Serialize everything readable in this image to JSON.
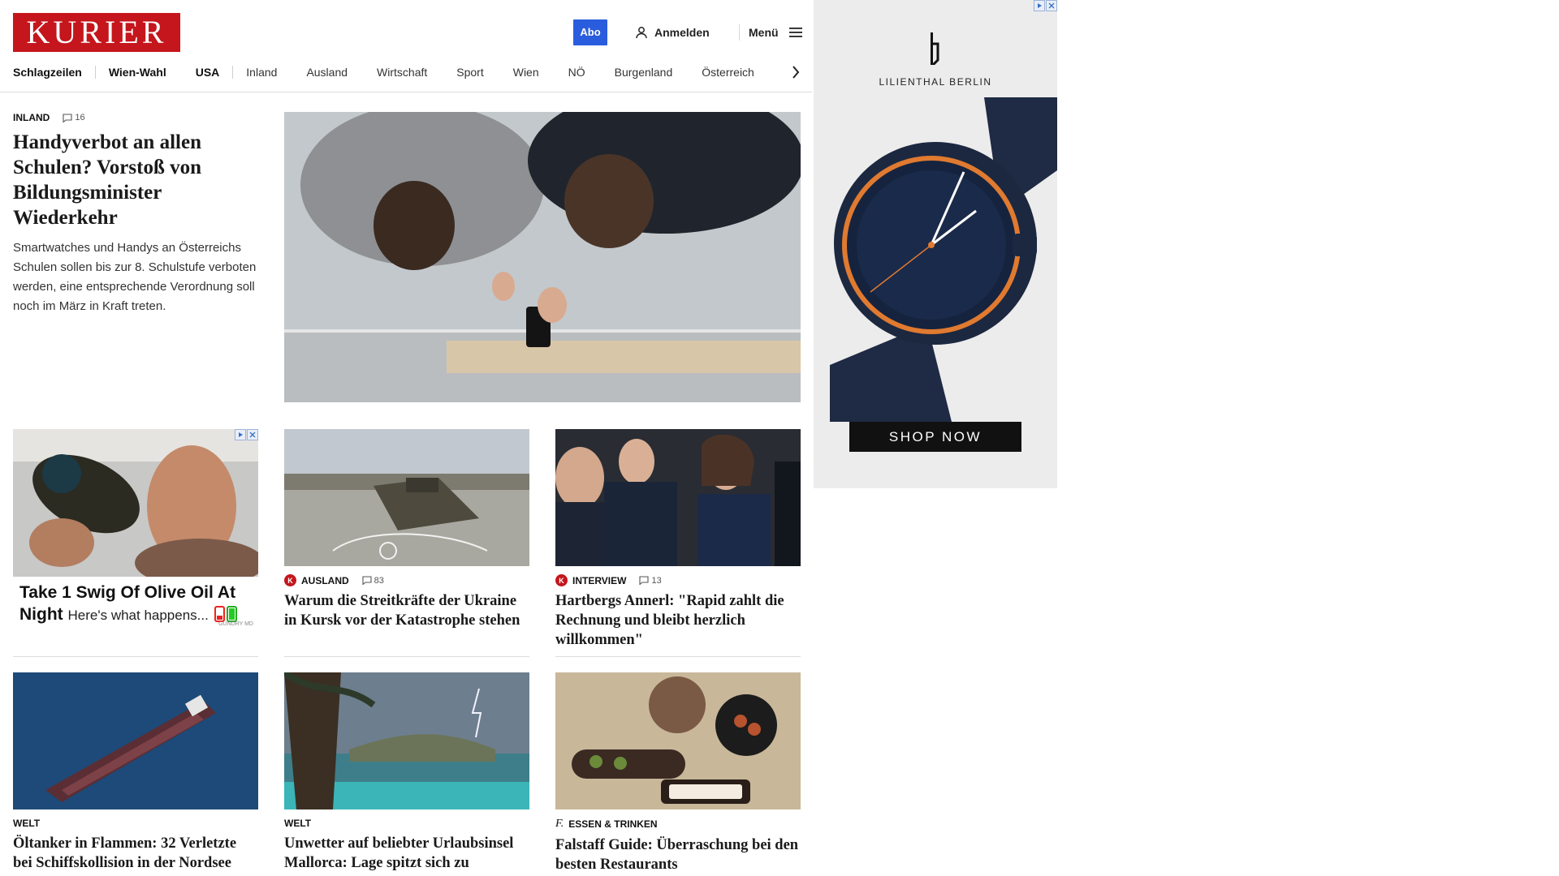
{
  "header": {
    "logo": "KURIER",
    "abo_label": "Abo",
    "login_label": "Anmelden",
    "menu_label": "Menü",
    "nav": [
      {
        "label": "Schlagzeilen",
        "bold": true
      },
      {
        "label": "Wien-Wahl",
        "bold": true
      },
      {
        "label": "USA",
        "bold": true
      },
      {
        "label": "Inland",
        "bold": false
      },
      {
        "label": "Ausland",
        "bold": false
      },
      {
        "label": "Wirtschaft",
        "bold": false
      },
      {
        "label": "Sport",
        "bold": false
      },
      {
        "label": "Wien",
        "bold": false
      },
      {
        "label": "NÖ",
        "bold": false
      },
      {
        "label": "Burgenland",
        "bold": false
      },
      {
        "label": "Österreich",
        "bold": false
      }
    ]
  },
  "top_story": {
    "category": "INLAND",
    "comments": "16",
    "title": "Handyverbot an allen Schulen? Vorstoß von Bildungsminister Wiederkehr",
    "teaser": "Smartwatches und Handys an Österreichs Schulen sollen bis zur 8. Schulstufe verboten werden, eine entsprechende Verordnung soll noch im März in Kraft treten."
  },
  "ad_small": {
    "headline": "Take 1 Swig Of Olive Oil At Night",
    "sub": "Here's what happens...",
    "brand": "GUNDRY MD"
  },
  "cards": [
    {
      "category": "AUSLAND",
      "comments": "83",
      "badge": "K",
      "title": "Warum die Streitkräfte der Ukraine in Kursk vor der Katastrophe stehen"
    },
    {
      "category": "INTERVIEW",
      "comments": "13",
      "badge": "K",
      "title": "Hartbergs Annerl: \"Rapid zahlt die Rechnung und bleibt herzlich willkommen\""
    },
    {
      "category": "WELT",
      "comments": "",
      "badge": "",
      "title": "Öltanker in Flammen: 32 Verletzte bei Schiffskollision in der Nordsee"
    },
    {
      "category": "WELT",
      "comments": "",
      "badge": "",
      "title": "Unwetter auf beliebter Urlaubsinsel Mallorca: Lage spitzt sich zu"
    },
    {
      "category": "ESSEN & TRINKEN",
      "comments": "",
      "badge": "f.",
      "title": "Falstaff Guide: Überraschung bei den besten Restaurants"
    }
  ],
  "ad_right": {
    "brand": "LILIENTHAL BERLIN",
    "cta": "SHOP NOW"
  },
  "colors": {
    "brand_red": "#c4161c",
    "abo_blue": "#2a5cde"
  }
}
